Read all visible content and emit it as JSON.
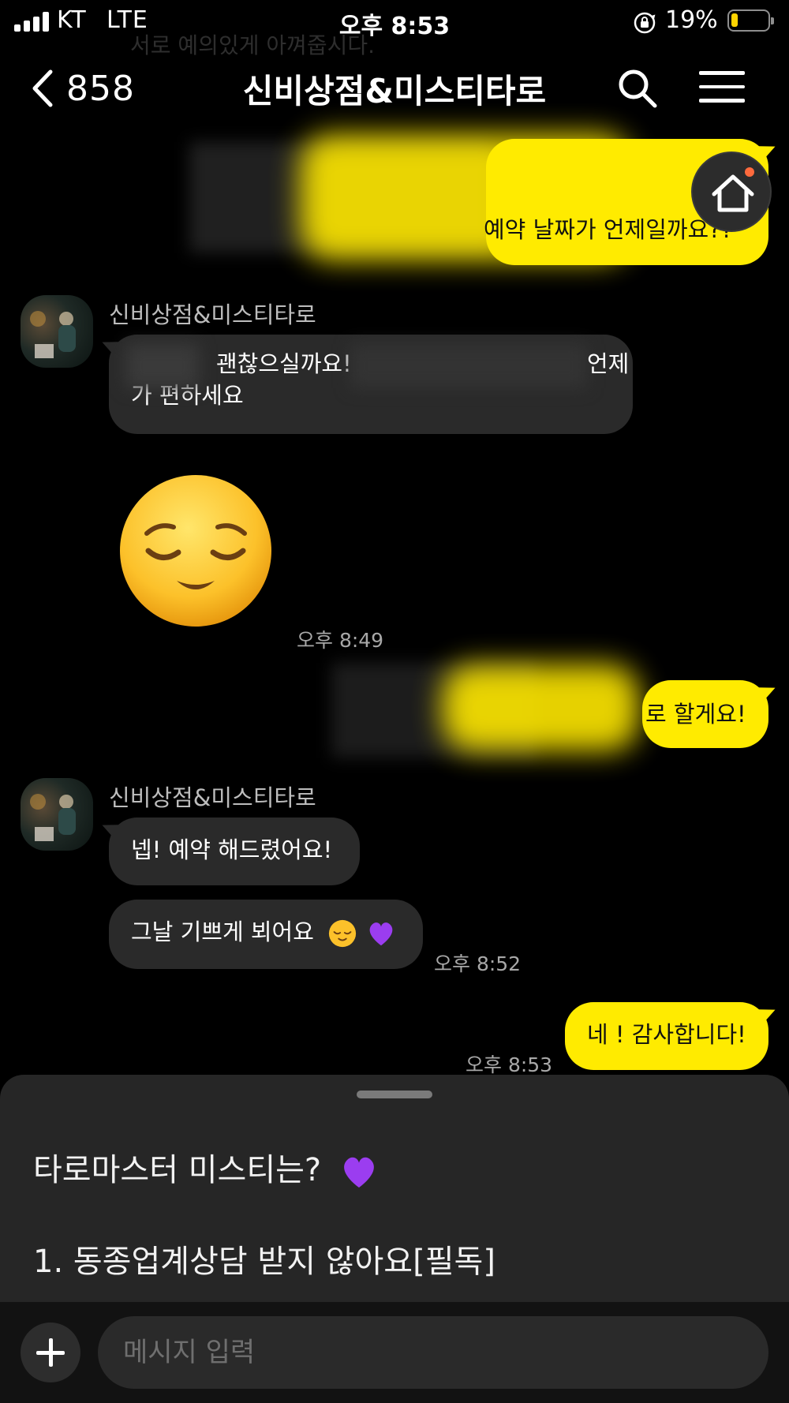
{
  "status_bar": {
    "carrier": "KT",
    "network": "LTE",
    "time": "오후 8:53",
    "battery": "19%",
    "battery_level": 0.19
  },
  "background_ghost_text": "서로 예의있게 아껴줍시다.",
  "header": {
    "back_count": "858",
    "title": "신비상점&미스티타로",
    "icons": {
      "back": "chevron-left-icon",
      "search": "search-icon",
      "menu": "menu-icon"
    }
  },
  "messages": [
    {
      "from": "me",
      "text": "예약 날짜가 언제일까요??",
      "redacted": true
    },
    {
      "from": "other",
      "sender": "신비상점&미스티타로",
      "line1_visible": "괜찮으실까요!",
      "line1_end": "언제",
      "line2": "가 편하세요",
      "redacted": true
    },
    {
      "from": "other",
      "type": "emoji",
      "emoji": "relieved-face-emoji",
      "time": "오후 8:49"
    },
    {
      "from": "me",
      "text": "로 할게요!",
      "redacted": true
    },
    {
      "from": "other",
      "sender": "신비상점&미스티타로",
      "text": "넵! 예약 해드렸어요!"
    },
    {
      "from": "other",
      "text": "그날 기쁘게 뵈어요",
      "emojis": [
        "relieved-face-emoji",
        "purple-heart-emoji"
      ],
      "time": "오후 8:52"
    },
    {
      "from": "me",
      "text": "네 ! 감사합니다!",
      "time": "오후 8:53"
    }
  ],
  "home_button": {
    "icon": "home-icon",
    "has_notification_dot": true
  },
  "notice_sheet": {
    "title": "타로마스터 미스티는?",
    "title_emoji": "purple-heart-emoji",
    "lines": [
      "1. 동종업계상담 받지 않아요[필독]"
    ]
  },
  "input_bar": {
    "placeholder": "메시지 입력",
    "plus_icon": "plus-icon"
  },
  "colors": {
    "my_bubble": "#ffeb00",
    "other_bubble": "#2a2a2a",
    "background": "#000000",
    "sheet": "#262626"
  }
}
